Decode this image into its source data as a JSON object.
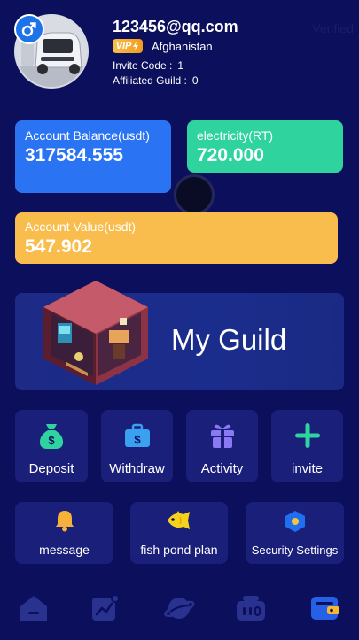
{
  "user": {
    "email": "123456@qq.com",
    "status": "Verified",
    "vip_label": "VIP",
    "country": "Afghanistan",
    "invite_code_label": "Invite Code :",
    "invite_code": "1",
    "affiliated_guild_label": "Affiliated Guild :",
    "affiliated_guild": "0",
    "gender_icon": "male-icon"
  },
  "cards": {
    "balance": {
      "label": "Account Balance(usdt)",
      "value": "317584.555",
      "color": "#2a74f4"
    },
    "electricity": {
      "label": "electricity(RT)",
      "value": "720.000",
      "color": "#2fd39e"
    },
    "account_value": {
      "label": "Account Value(usdt)",
      "value": "547.902",
      "color": "#f9bd4d"
    }
  },
  "guild": {
    "title": "My Guild"
  },
  "actions": [
    {
      "label": "Deposit",
      "icon": "money-bag-icon"
    },
    {
      "label": "Withdraw",
      "icon": "wallet-icon"
    },
    {
      "label": "Activity",
      "icon": "gift-icon"
    },
    {
      "label": "invite",
      "icon": "plus-icon"
    }
  ],
  "features": [
    {
      "label": "message",
      "icon": "bell-icon"
    },
    {
      "label": "fish pond plan",
      "icon": "fish-icon"
    },
    {
      "label": "Security Settings",
      "icon": "hexagon-icon"
    }
  ],
  "nav": [
    {
      "icon": "home-icon"
    },
    {
      "icon": "chart-icon"
    },
    {
      "icon": "planet-icon"
    },
    {
      "icon": "ticket-icon"
    },
    {
      "icon": "wallet-icon",
      "active": true
    }
  ],
  "colors": {
    "background": "#0b0f5c",
    "tile": "#1a1f7a",
    "nav_inactive": "#2a3290",
    "nav_active": "#2660e6"
  }
}
